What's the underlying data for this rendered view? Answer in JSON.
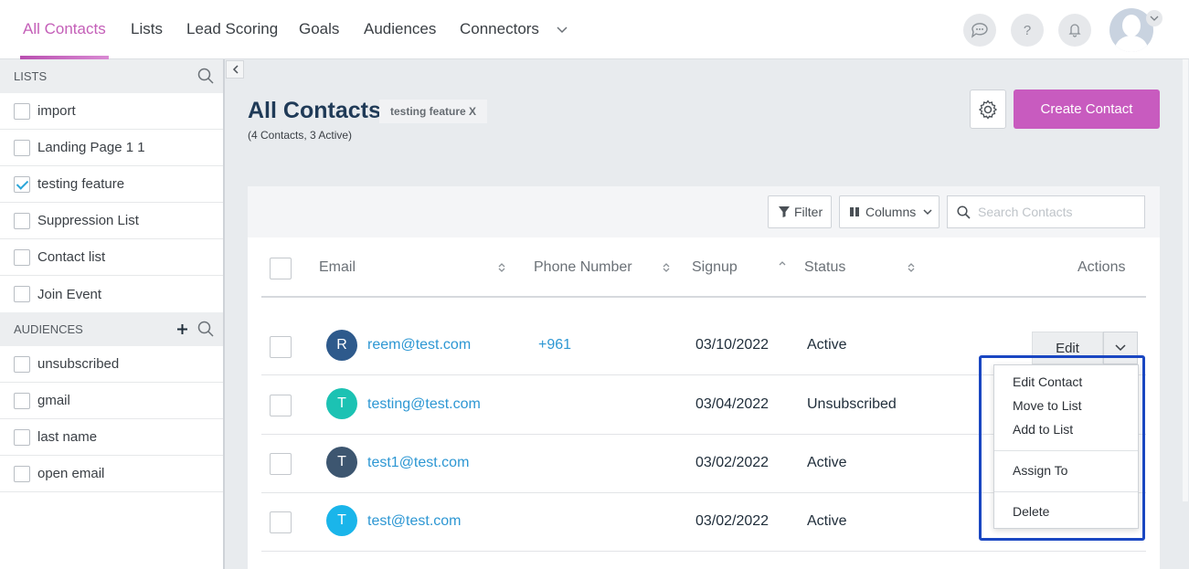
{
  "nav": {
    "tabs": [
      {
        "label": "All Contacts",
        "active": true
      },
      {
        "label": "Lists"
      },
      {
        "label": "Lead Scoring"
      },
      {
        "label": "Goals"
      },
      {
        "label": "Audiences"
      },
      {
        "label": "Connectors"
      }
    ],
    "icons": [
      "chat-icon",
      "help-icon",
      "bell-icon",
      "user-avatar"
    ],
    "help_glyph": "?"
  },
  "sidebar": {
    "lists_header": "LISTS",
    "lists": [
      {
        "label": "import",
        "checked": false
      },
      {
        "label": "Landing Page 1 1",
        "checked": false
      },
      {
        "label": "testing feature",
        "checked": true
      },
      {
        "label": "Suppression List",
        "checked": false
      },
      {
        "label": "Contact list",
        "checked": false
      },
      {
        "label": "Join Event",
        "checked": false
      }
    ],
    "audiences_header": "AUDIENCES",
    "audiences": [
      {
        "label": "unsubscribed"
      },
      {
        "label": "gmail"
      },
      {
        "label": "last name"
      },
      {
        "label": "open email"
      }
    ]
  },
  "header": {
    "title": "All Contacts",
    "filter_tag": "testing feature X",
    "subtitle": "(4 Contacts, 3 Active)",
    "create_button": "Create Contact"
  },
  "toolbar": {
    "filter_label": "Filter",
    "columns_label": "Columns",
    "search_placeholder": "Search Contacts"
  },
  "table": {
    "columns": [
      "Email",
      "Phone Number",
      "Signup",
      "Status",
      "Actions"
    ],
    "rows": [
      {
        "initial": "R",
        "avatar_color": "#2e5a8c",
        "email": "reem@test.com",
        "phone": "+961",
        "signup": "03/10/2022",
        "status": "Active"
      },
      {
        "initial": "T",
        "avatar_color": "#1cc2b3",
        "email": "testing@test.com",
        "phone": "",
        "signup": "03/04/2022",
        "status": "Unsubscribed"
      },
      {
        "initial": "T",
        "avatar_color": "#3d5670",
        "email": "test1@test.com",
        "phone": "",
        "signup": "03/02/2022",
        "status": "Active"
      },
      {
        "initial": "T",
        "avatar_color": "#1ab5ea",
        "email": "test@test.com",
        "phone": "",
        "signup": "03/02/2022",
        "status": "Active"
      }
    ],
    "edit_label": "Edit"
  },
  "action_menu": {
    "items": [
      "Edit Contact",
      "Move to List",
      "Add to List",
      "Assign To",
      "Delete"
    ]
  },
  "colors": {
    "accent": "#c85bbf",
    "link": "#2d97d3",
    "highlight": "#1a47c2"
  }
}
